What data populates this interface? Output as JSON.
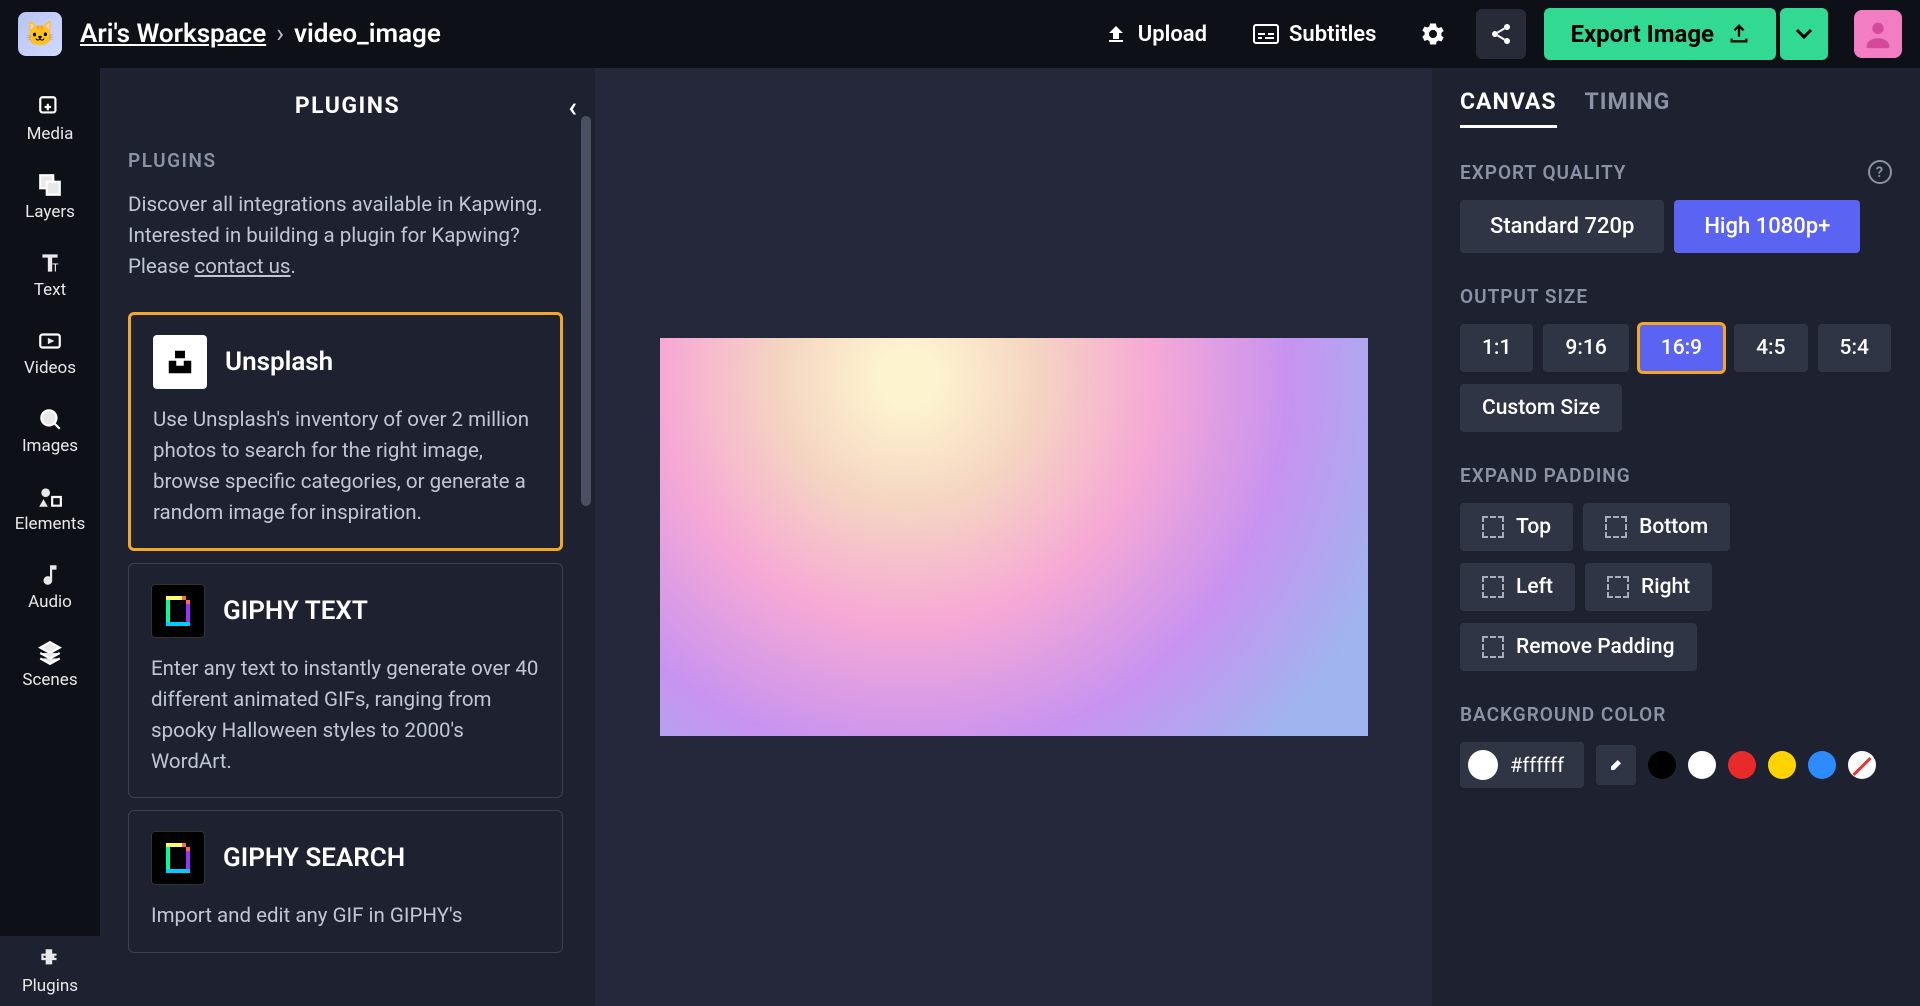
{
  "header": {
    "workspace": "Ari's Workspace",
    "breadcrumb_sep": "›",
    "project": "video_image",
    "upload": "Upload",
    "subtitles": "Subtitles",
    "export": "Export Image"
  },
  "rail": {
    "items": [
      {
        "label": "Media"
      },
      {
        "label": "Layers"
      },
      {
        "label": "Text"
      },
      {
        "label": "Videos"
      },
      {
        "label": "Images"
      },
      {
        "label": "Elements"
      },
      {
        "label": "Audio"
      },
      {
        "label": "Scenes"
      },
      {
        "label": "Plugins"
      }
    ]
  },
  "panel": {
    "title": "PLUGINS",
    "subhead": "PLUGINS",
    "desc_pre": "Discover all integrations available in Kapwing. Interested in building a plugin for Kapwing? Please ",
    "desc_link": "contact us",
    "desc_post": ".",
    "plugins": [
      {
        "name": "Unsplash",
        "desc": "Use Unsplash's inventory of over 2 million photos to search for the right image, browse specific categories, or generate a random image for inspiration."
      },
      {
        "name": "GIPHY TEXT",
        "desc": "Enter any text to instantly generate over 40 different animated GIFs, ranging from spooky Halloween styles to 2000's WordArt."
      },
      {
        "name": "GIPHY SEARCH",
        "desc": "Import and edit any GIF in GIPHY's"
      }
    ]
  },
  "sidebar": {
    "tabs": {
      "canvas": "CANVAS",
      "timing": "TIMING"
    },
    "export_quality": {
      "label": "EXPORT QUALITY",
      "standard": "Standard 720p",
      "high": "High 1080p+"
    },
    "output_size": {
      "label": "OUTPUT SIZE",
      "ratios": [
        "1:1",
        "9:16",
        "16:9",
        "4:5",
        "5:4"
      ],
      "custom": "Custom Size"
    },
    "expand_padding": {
      "label": "EXPAND PADDING",
      "top": "Top",
      "bottom": "Bottom",
      "left": "Left",
      "right": "Right",
      "remove": "Remove Padding"
    },
    "bg_color": {
      "label": "BACKGROUND COLOR",
      "hex": "#ffffff",
      "swatches": [
        "#000000",
        "#ffffff",
        "#e82a2a",
        "#ffd400",
        "#2e8bff"
      ]
    }
  }
}
